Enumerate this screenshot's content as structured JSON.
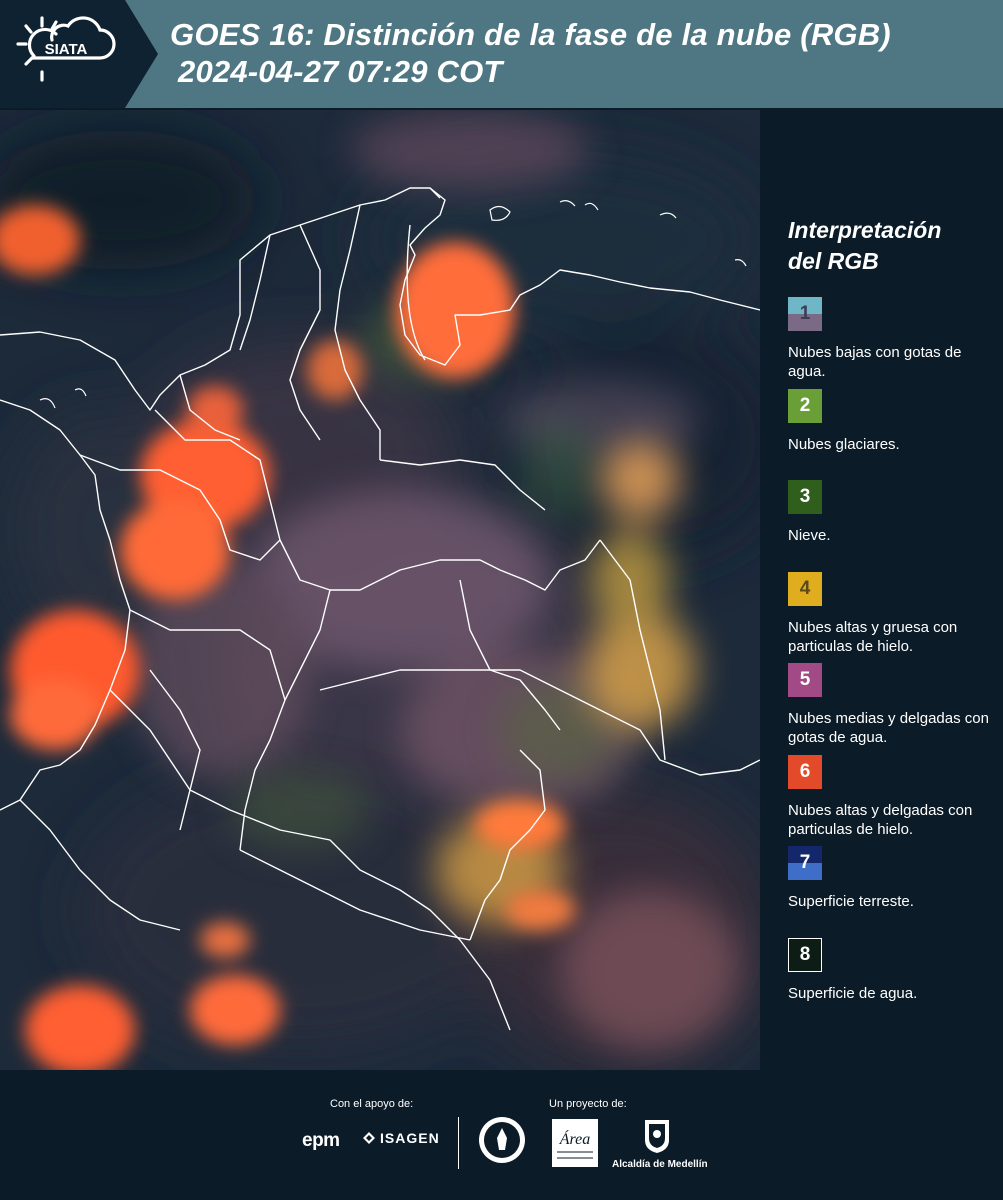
{
  "header": {
    "logo_text": "SIATA",
    "title_line1": "GOES 16: Distinción de la fase de la nube (RGB)",
    "title_line2": "2024-04-27 07:29 COT"
  },
  "legend": {
    "title_line1": "Interpretación",
    "title_line2": "del RGB",
    "items": [
      {
        "number": "1",
        "label": "Nubes bajas con gotas de agua.",
        "color_top": "#6fb7c6",
        "color_bottom": "#7b6a86",
        "text_color": "#3c3c55"
      },
      {
        "number": "2",
        "label": "Nubes glaciares.",
        "color_top": "#6a9f38",
        "color_bottom": "#6a9f38",
        "text_color": "#ffffff"
      },
      {
        "number": "3",
        "label": "Nieve.",
        "color_top": "#2f5e1d",
        "color_bottom": "#2f5e1d",
        "text_color": "#ffffff"
      },
      {
        "number": "4",
        "label": "Nubes altas y gruesa con particulas de hielo.",
        "color_top": "#e0ad1f",
        "color_bottom": "#e0ad1f",
        "text_color": "#5a4a1a"
      },
      {
        "number": "5",
        "label": "Nubes medias y delgadas con gotas de agua.",
        "color_top": "#a14a86",
        "color_bottom": "#a14a86",
        "text_color": "#ffffff"
      },
      {
        "number": "6",
        "label": "Nubes altas y delgadas con particulas de hielo.",
        "color_top": "#e34a2a",
        "color_bottom": "#e34a2a",
        "text_color": "#ffffff"
      },
      {
        "number": "7",
        "label": "Superficie terreste.",
        "color_top": "#14276a",
        "color_bottom": "#3f6ec9",
        "text_color": "#ffffff"
      },
      {
        "number": "8",
        "label": "Superficie de agua.",
        "color_top": "#0d1c14",
        "color_bottom": "#0d1c14",
        "text_color": "#ffffff"
      }
    ]
  },
  "footer": {
    "support_label": "Con el apoyo de:",
    "project_label": "Un proyecto de:",
    "sponsor_1": "epm",
    "sponsor_2": "ISAGEN",
    "area_logo_text": "Área",
    "alcaldia_label": "Alcaldía de Medellín"
  },
  "colors": {
    "header_band": "#4f7683",
    "header_dark": "#0e2231",
    "background": "#0b1b27",
    "cloud_orange": "#ff6a35",
    "cloud_yellow": "#e0a84a",
    "cloud_pink": "#8a6a80"
  }
}
